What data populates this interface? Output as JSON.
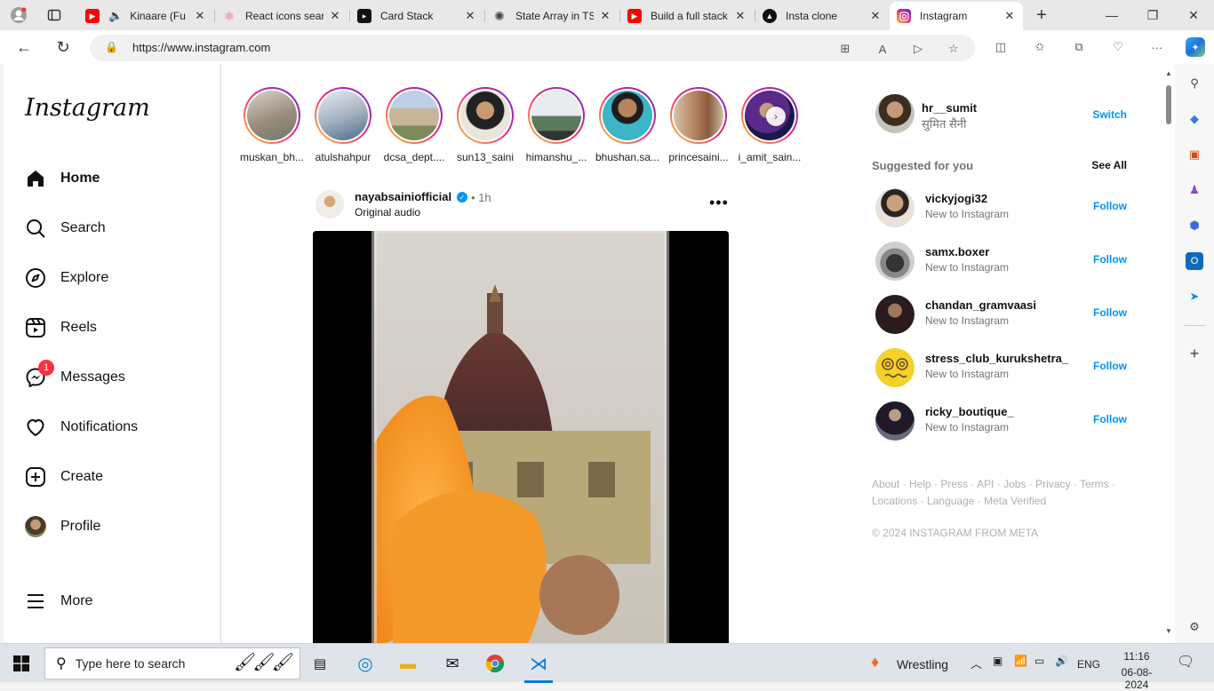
{
  "browser": {
    "tabs": [
      {
        "title": "Kinaare (Fu",
        "favicon": "youtube-icon",
        "color": "#ff0000",
        "muted_icon": "speaker-icon"
      },
      {
        "title": "React icons sear",
        "favicon": "react-icon",
        "color": "#e0457b"
      },
      {
        "title": "Card Stack",
        "favicon": "card-stack-icon",
        "color": "#111111"
      },
      {
        "title": "State Array in TS",
        "favicon": "chatgpt-icon",
        "color": "#444444"
      },
      {
        "title": "Build a full stack",
        "favicon": "youtube-icon",
        "color": "#ff0000"
      },
      {
        "title": "Insta clone",
        "favicon": "triangle-icon",
        "color": "#111111"
      },
      {
        "title": "Instagram",
        "favicon": "instagram-icon",
        "color": "#d62976",
        "active": true
      }
    ],
    "url": "https://www.instagram.com"
  },
  "sidebar": {
    "logo": "Instagram",
    "items": [
      {
        "label": "Home",
        "icon": "home-icon"
      },
      {
        "label": "Search",
        "icon": "search-icon"
      },
      {
        "label": "Explore",
        "icon": "compass-icon"
      },
      {
        "label": "Reels",
        "icon": "reels-icon"
      },
      {
        "label": "Messages",
        "icon": "messenger-icon",
        "badge": "1"
      },
      {
        "label": "Notifications",
        "icon": "heart-icon"
      },
      {
        "label": "Create",
        "icon": "plus-square-icon"
      },
      {
        "label": "Profile",
        "icon": "profile-avatar"
      },
      {
        "label": "More",
        "icon": "hamburger-icon"
      }
    ]
  },
  "stories": [
    {
      "name": "muskan_bh..."
    },
    {
      "name": "atulshahpur"
    },
    {
      "name": "dcsa_dept...."
    },
    {
      "name": "sun13_saini"
    },
    {
      "name": "himanshu_..."
    },
    {
      "name": "bhushan.sa..."
    },
    {
      "name": "princesaini..."
    },
    {
      "name": "i_amit_sain..."
    }
  ],
  "post": {
    "username": "nayabsainiofficial",
    "separator": "•",
    "time": "1h",
    "audio": "Original audio",
    "more": "•••"
  },
  "right": {
    "user": {
      "username": "hr__sumit",
      "fullname": "सुमित सैनी",
      "action": "Switch"
    },
    "suggested_title": "Suggested for you",
    "see_all": "See All",
    "suggestions": [
      {
        "username": "vickyjogi32",
        "sub": "New to Instagram",
        "action": "Follow"
      },
      {
        "username": "samx.boxer",
        "sub": "New to Instagram",
        "action": "Follow"
      },
      {
        "username": "chandan_gramvaasi",
        "sub": "New to Instagram",
        "action": "Follow"
      },
      {
        "username": "stress_club_kurukshetra_",
        "sub": "New to Instagram",
        "action": "Follow"
      },
      {
        "username": "ricky_boutique_",
        "sub": "New to Instagram",
        "action": "Follow"
      }
    ],
    "footer_links": [
      "About",
      "Help",
      "Press",
      "API",
      "Jobs",
      "Privacy",
      "Terms",
      "Locations",
      "Language",
      "Meta Verified"
    ],
    "copyright": "© 2024 INSTAGRAM FROM META"
  },
  "taskbar": {
    "search_placeholder": "Type here to search",
    "weather": "Wrestling",
    "language": "ENG",
    "time": "11:16",
    "date": "06-08-2024"
  },
  "colors": {
    "accent": "#0095f6",
    "badge": "#ff3040"
  }
}
